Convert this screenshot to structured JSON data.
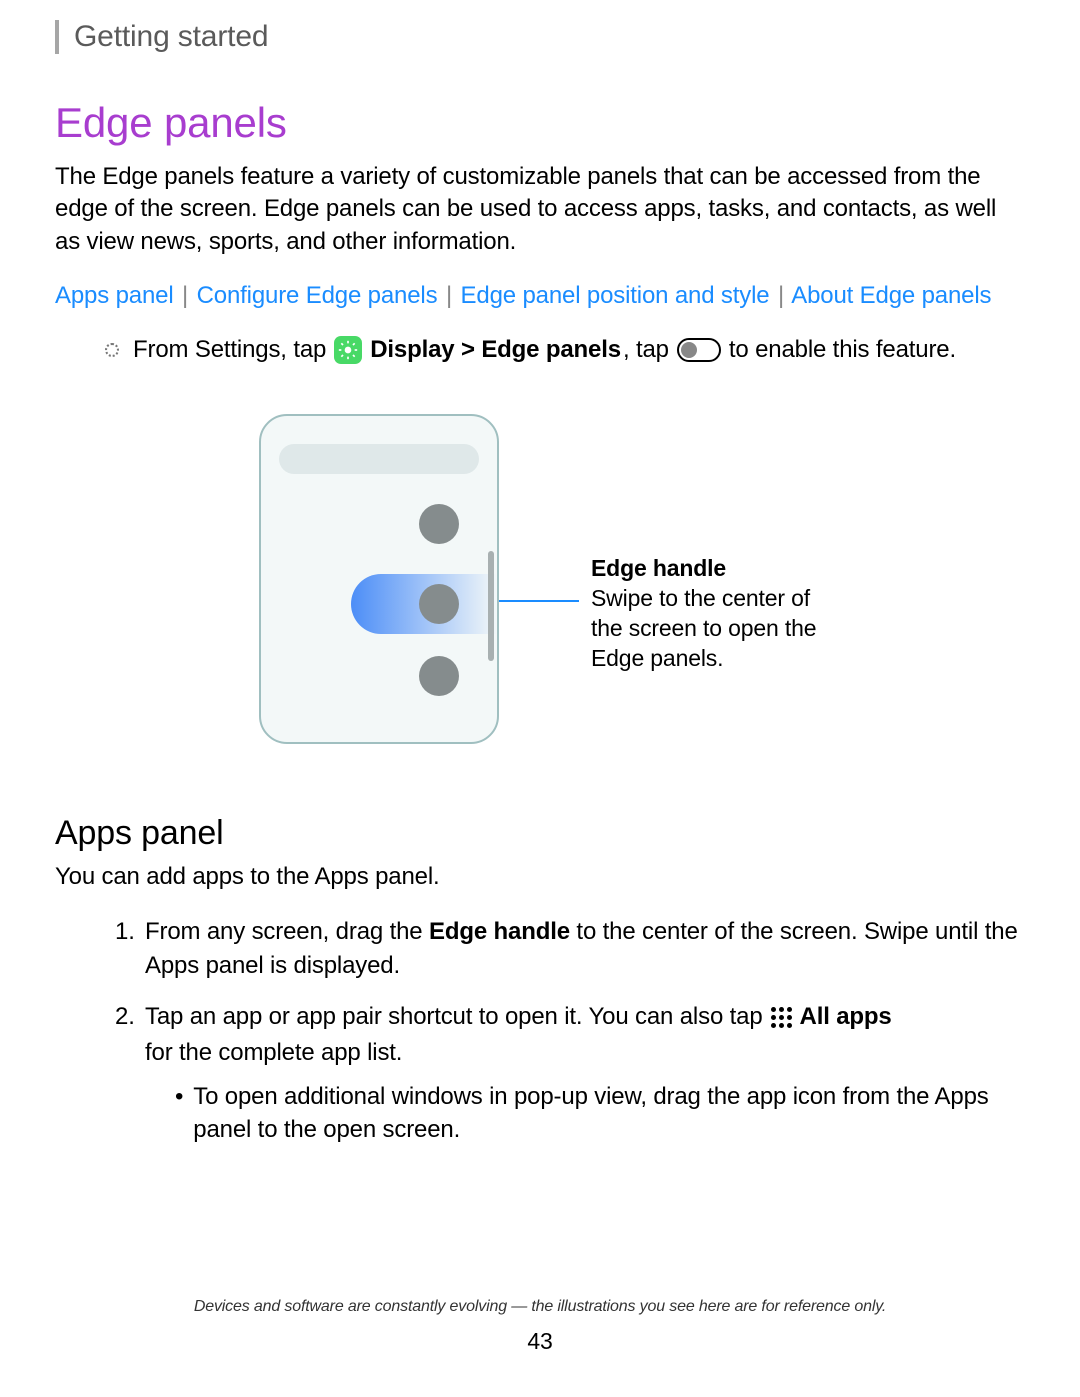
{
  "breadcrumb": "Getting started",
  "heading": "Edge panels",
  "intro": "The Edge panels feature a variety of customizable panels that can be accessed from the edge of the screen. Edge panels can be used to access apps, tasks, and contacts, as well as view news, sports, and other information.",
  "links": {
    "apps_panel": "Apps panel",
    "configure": "Configure Edge panels",
    "position": "Edge panel position and style",
    "about": "About Edge panels",
    "sep": "|"
  },
  "instruction": {
    "prefix": "From Settings, tap ",
    "display_path": "Display > Edge panels",
    "mid": ", tap ",
    "suffix": " to enable this feature."
  },
  "callout": {
    "title": "Edge handle",
    "desc": "Swipe to the center of the screen to open the Edge panels."
  },
  "section2": {
    "heading": "Apps panel",
    "intro": "You can add apps to the Apps panel."
  },
  "steps": {
    "s1_num": "1.",
    "s1_a": "From any screen, drag the ",
    "s1_bold": "Edge handle",
    "s1_b": " to the center of the screen. Swipe until the Apps panel is displayed.",
    "s2_num": "2.",
    "s2_a": "Tap an app or app pair shortcut to open it. You can also tap",
    "s2_allapps": "All apps",
    "s2_b": " for the complete app list.",
    "s2_sub": "To open additional windows in pop-up view, drag the app icon from the Apps panel to the open screen."
  },
  "footer_note": "Devices and software are constantly evolving — the illustrations you see here are for reference only.",
  "page_number": "43"
}
